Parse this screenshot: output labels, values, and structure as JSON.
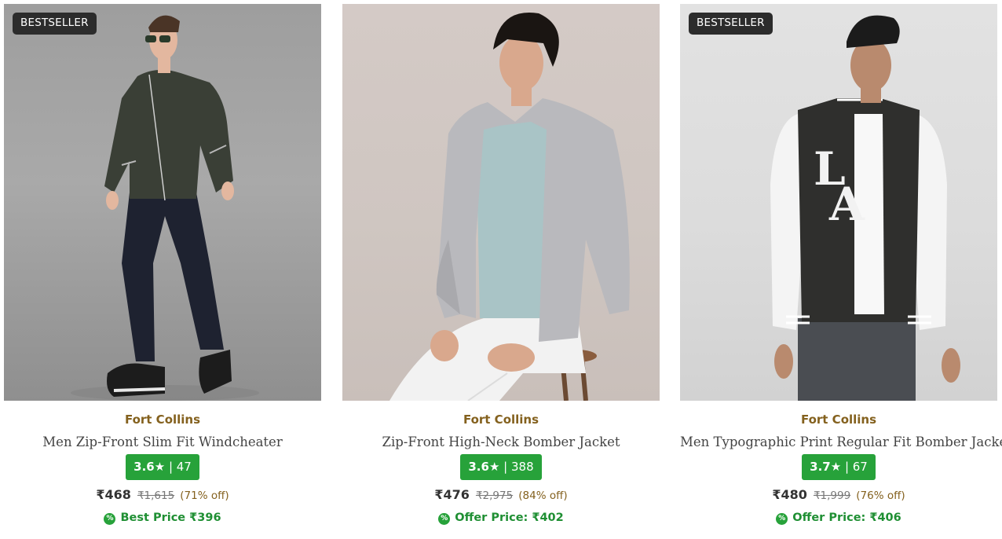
{
  "products": [
    {
      "badge": "BESTSELLER",
      "brand": "Fort Collins",
      "title": "Men Zip-Front Slim Fit Windcheater",
      "rating": "3.6",
      "rating_count": "47",
      "price": "₹468",
      "mrp": "₹1,615",
      "discount": "(71% off)",
      "offer_text": "Best Price ₹396",
      "image_icon": "product-photo"
    },
    {
      "badge": "",
      "brand": "Fort Collins",
      "title": "Zip-Front High-Neck Bomber Jacket",
      "rating": "3.6",
      "rating_count": "388",
      "price": "₹476",
      "mrp": "₹2,975",
      "discount": "(84% off)",
      "offer_text": "Offer Price: ₹402",
      "image_icon": "product-photo"
    },
    {
      "badge": "BESTSELLER",
      "brand": "Fort Collins",
      "title": "Men Typographic Print Regular Fit Bomber Jacket",
      "rating": "3.7",
      "rating_count": "67",
      "price": "₹480",
      "mrp": "₹1,999",
      "discount": "(76% off)",
      "offer_text": "Offer Price: ₹406",
      "image_icon": "product-photo"
    }
  ],
  "icons": {
    "rating_star": "★",
    "offer_badge": "%"
  },
  "colors": {
    "brand_text": "#84611e",
    "rating_bg": "#27a23a",
    "offer_text": "#1f8f33",
    "badge_bg": "#2c2c2c"
  }
}
